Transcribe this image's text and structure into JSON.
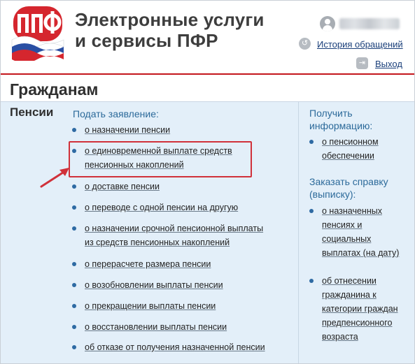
{
  "header": {
    "title_line1": "Электронные услуги",
    "title_line2": "и сервисы ПФР",
    "history_link": "История обращений",
    "logout_link": "Выход",
    "logo_text": "ПФР"
  },
  "section": {
    "title": "Гражданам"
  },
  "category": {
    "title": "Пенсии"
  },
  "middle": {
    "heading": "Подать заявление:",
    "items": [
      {
        "lines": [
          "о назначении пенсии"
        ]
      },
      {
        "lines": [
          "о единовременной выплате средств",
          "пенсионных накоплений"
        ]
      },
      {
        "lines": [
          "о доставке пенсии"
        ]
      },
      {
        "lines": [
          "о переводе с одной пенсии на другую"
        ]
      },
      {
        "lines": [
          "о назначении срочной пенсионной выплаты",
          "из средств пенсионных накоплений"
        ]
      },
      {
        "lines": [
          "о перерасчете размера пенсии"
        ]
      },
      {
        "lines": [
          "о возобновлении выплаты пенсии"
        ]
      },
      {
        "lines": [
          "о прекращении выплаты пенсии"
        ]
      },
      {
        "lines": [
          "о восстановлении выплаты пенсии"
        ]
      },
      {
        "lines": [
          "об отказе от получения назначенной пенсии"
        ]
      }
    ]
  },
  "right": {
    "heading1": [
      "Получить",
      "информацию:"
    ],
    "items1": [
      {
        "lines": [
          "о пенсионном",
          "обеспечении"
        ]
      }
    ],
    "heading2": [
      "Заказать справку",
      "(выписку):"
    ],
    "items2": [
      {
        "lines": [
          "о назначенных",
          "пенсиях и",
          "социальных",
          "выплатах (на дату)"
        ]
      },
      {
        "lines": [
          "об отнесении",
          "гражданина к",
          "категории граждан",
          "предпенсионного",
          "возраста"
        ]
      }
    ]
  },
  "colors": {
    "accent_red": "#c4161c",
    "link_blue": "#1a3f7a",
    "content_bg": "#e3eff9",
    "heading_blue": "#2c6a9a"
  },
  "icons": {
    "user": "user-avatar-icon",
    "history": "history-clock-icon",
    "logout": "logout-door-icon"
  }
}
